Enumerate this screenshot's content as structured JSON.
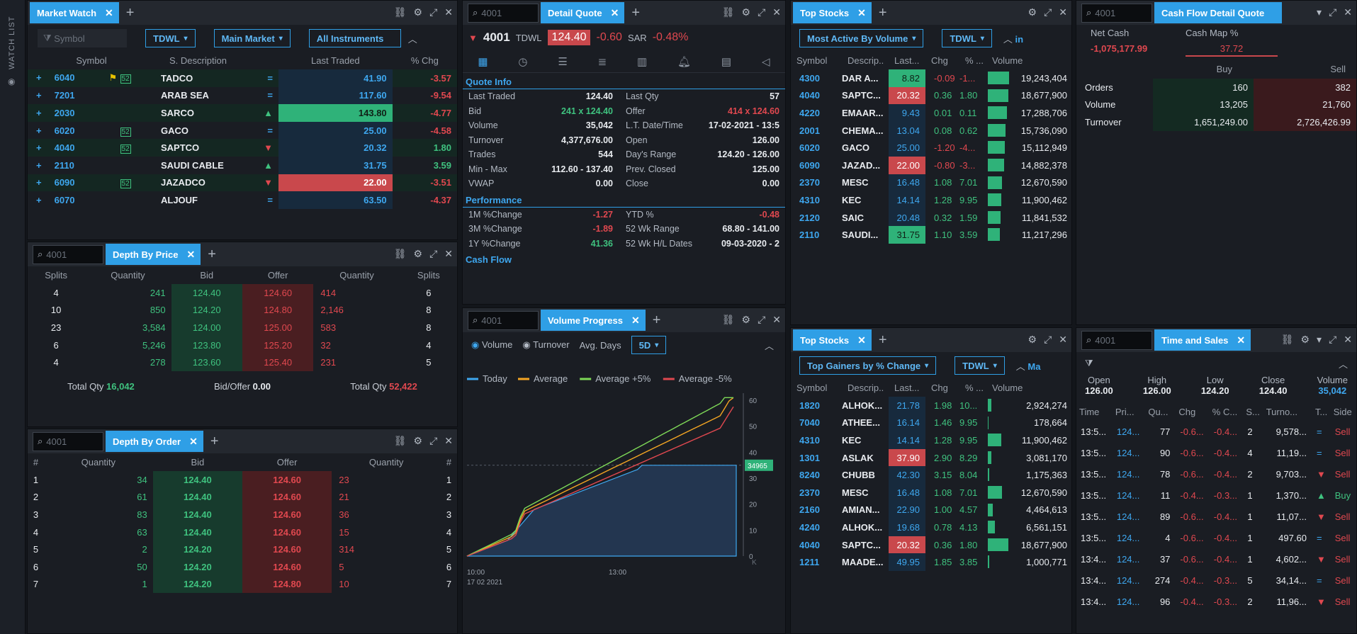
{
  "sidebar": {
    "label": "WATCH LIST",
    "eye": "◉"
  },
  "common": {
    "plus": "+",
    "close": "✕",
    "search_icon": "⌕",
    "chev": "⌄",
    "up": "︿"
  },
  "mw": {
    "tab": "Market Watch",
    "filter_placeholder": "Symbol",
    "dd1": "TDWL",
    "dd2": "Main Market",
    "dd3": "All Instruments",
    "headers": [
      "Symbol",
      "S. Description",
      "Last Traded",
      "% Chg"
    ],
    "rows": [
      {
        "sym": "6040",
        "desc": "TADCO",
        "last": "41.90",
        "chg": "-3.57",
        "flag": "⚑",
        "badge": "52",
        "tr": "=",
        "dir": "dn",
        "hl": ""
      },
      {
        "sym": "7201",
        "desc": "ARAB SEA",
        "last": "117.60",
        "chg": "-9.54",
        "flag": "",
        "badge": "",
        "tr": "=",
        "dir": "dn",
        "hl": ""
      },
      {
        "sym": "2030",
        "desc": "SARCO",
        "last": "143.80",
        "chg": "-4.77",
        "flag": "",
        "badge": "",
        "tr": "▲",
        "dir": "dn",
        "hl": "g"
      },
      {
        "sym": "6020",
        "desc": "GACO",
        "last": "25.00",
        "chg": "-4.58",
        "flag": "",
        "badge": "52",
        "tr": "=",
        "dir": "dn",
        "hl": ""
      },
      {
        "sym": "4040",
        "desc": "SAPTCO",
        "last": "20.32",
        "chg": "1.80",
        "flag": "",
        "badge": "52",
        "tr": "▼",
        "dir": "up",
        "hl": ""
      },
      {
        "sym": "2110",
        "desc": "SAUDI CABLE",
        "last": "31.75",
        "chg": "3.59",
        "flag": "",
        "badge": "",
        "tr": "▲",
        "dir": "up",
        "hl": ""
      },
      {
        "sym": "6090",
        "desc": "JAZADCO",
        "last": "22.00",
        "chg": "-3.51",
        "flag": "",
        "badge": "52",
        "tr": "▼",
        "dir": "dn",
        "hl": "r"
      },
      {
        "sym": "6070",
        "desc": "ALJOUF",
        "last": "63.50",
        "chg": "-4.37",
        "flag": "",
        "badge": "",
        "tr": "=",
        "dir": "dn",
        "hl": ""
      }
    ]
  },
  "dbp": {
    "search": "4001",
    "tab": "Depth By Price",
    "headers": [
      "Splits",
      "Quantity",
      "Bid",
      "Offer",
      "Quantity",
      "Splits"
    ],
    "rows": [
      [
        "4",
        "241",
        "124.40",
        "124.60",
        "414",
        "6"
      ],
      [
        "10",
        "850",
        "124.20",
        "124.80",
        "2,146",
        "8"
      ],
      [
        "23",
        "3,584",
        "124.00",
        "125.00",
        "583",
        "8"
      ],
      [
        "6",
        "5,246",
        "123.80",
        "125.20",
        "32",
        "4"
      ],
      [
        "4",
        "278",
        "123.60",
        "125.40",
        "231",
        "5"
      ]
    ],
    "footer": {
      "tq_label": "Total Qty",
      "tq_bid": "16,042",
      "bo_label": "Bid/Offer",
      "bo": "0.00",
      "tq_label2": "Total Qty",
      "tq_ask": "52,422"
    }
  },
  "dbo": {
    "search": "4001",
    "tab": "Depth By Order",
    "headers": [
      "#",
      "Quantity",
      "Bid",
      "Offer",
      "Quantity",
      "#"
    ],
    "rows": [
      [
        "1",
        "34",
        "124.40",
        "124.60",
        "23",
        "1"
      ],
      [
        "2",
        "61",
        "124.40",
        "124.60",
        "21",
        "2"
      ],
      [
        "3",
        "83",
        "124.40",
        "124.60",
        "36",
        "3"
      ],
      [
        "4",
        "63",
        "124.40",
        "124.60",
        "15",
        "4"
      ],
      [
        "5",
        "2",
        "124.20",
        "124.60",
        "314",
        "5"
      ],
      [
        "6",
        "50",
        "124.20",
        "124.60",
        "5",
        "6"
      ],
      [
        "7",
        "1",
        "124.20",
        "124.80",
        "10",
        "7"
      ]
    ]
  },
  "dq": {
    "search": "4001",
    "tab": "Detail Quote",
    "sym": "4001",
    "exch": "TDWL",
    "price": "124.40",
    "chg": "-0.60",
    "cur": "SAR",
    "pct": "-0.48%",
    "sec_quote": "Quote Info",
    "sec_perf": "Performance",
    "sec_cash": "Cash Flow",
    "qi": [
      [
        "Last Traded",
        "124.40",
        "Last Qty",
        "57"
      ],
      [
        "Bid",
        "241 x 124.40",
        "Offer",
        "414 x 124.60"
      ],
      [
        "Volume",
        "35,042",
        "L.T. Date/Time",
        "17-02-2021 - 13:5"
      ],
      [
        "Turnover",
        "4,377,676.00",
        "Open",
        "126.00"
      ],
      [
        "Trades",
        "544",
        "Day's Range",
        "124.20 - 126.00"
      ],
      [
        "Min - Max",
        "112.60 - 137.40",
        "Prev. Closed",
        "125.00"
      ],
      [
        "VWAP",
        "0.00",
        "Close",
        "0.00"
      ]
    ],
    "perf": [
      [
        "1M %Change",
        "-1.27",
        "YTD %",
        "-0.48"
      ],
      [
        "3M %Change",
        "-1.89",
        "52 Wk Range",
        "68.80 - 141.00"
      ],
      [
        "1Y %Change",
        "41.36",
        "52 Wk H/L Dates",
        "09-03-2020 - 2"
      ]
    ]
  },
  "vp": {
    "search": "4001",
    "tab": "Volume Progress",
    "opt1": "Volume",
    "opt2": "Turnover",
    "avg_label": "Avg. Days",
    "avg_dd": "5D",
    "legend": [
      "Today",
      "Average",
      "Average +5%",
      "Average -5%"
    ],
    "xt": [
      "10:00",
      "13:00"
    ],
    "date": "17 02 2021",
    "yt": [
      "60",
      "50",
      "40",
      "30",
      "20",
      "10",
      "0"
    ],
    "marker": "34965",
    "corner": "K"
  },
  "ts1": {
    "tab": "Top Stocks",
    "dd1": "Most Active By Volume",
    "dd2": "TDWL",
    "more": "in",
    "headers": [
      "Symbol",
      "Descrip..",
      "Last...",
      "Chg",
      "% ...",
      "Volume"
    ],
    "rows": [
      {
        "sym": "4300",
        "d": "DAR A...",
        "l": "8.82",
        "c": "-0.09",
        "p": "-1...",
        "v": "19,243,404",
        "bw": 1.0,
        "hl": "g",
        "dir": "dn"
      },
      {
        "sym": "4040",
        "d": "SAPTC...",
        "l": "20.32",
        "c": "0.36",
        "p": "1.80",
        "v": "18,677,900",
        "bw": 0.97,
        "hl": "r",
        "dir": "up"
      },
      {
        "sym": "4220",
        "d": "EMAAR...",
        "l": "9.43",
        "c": "0.01",
        "p": "0.11",
        "v": "17,288,706",
        "bw": 0.9,
        "hl": "",
        "dir": "up"
      },
      {
        "sym": "2001",
        "d": "CHEMA...",
        "l": "13.04",
        "c": "0.08",
        "p": "0.62",
        "v": "15,736,090",
        "bw": 0.82,
        "hl": "",
        "dir": "up"
      },
      {
        "sym": "6020",
        "d": "GACO",
        "l": "25.00",
        "c": "-1.20",
        "p": "-4...",
        "v": "15,112,949",
        "bw": 0.79,
        "hl": "",
        "dir": "dn"
      },
      {
        "sym": "6090",
        "d": "JAZAD...",
        "l": "22.00",
        "c": "-0.80",
        "p": "-3...",
        "v": "14,882,378",
        "bw": 0.77,
        "hl": "r",
        "dir": "dn"
      },
      {
        "sym": "2370",
        "d": "MESC",
        "l": "16.48",
        "c": "1.08",
        "p": "7.01",
        "v": "12,670,590",
        "bw": 0.66,
        "hl": "",
        "dir": "up"
      },
      {
        "sym": "4310",
        "d": "KEC",
        "l": "14.14",
        "c": "1.28",
        "p": "9.95",
        "v": "11,900,462",
        "bw": 0.62,
        "hl": "",
        "dir": "up"
      },
      {
        "sym": "2120",
        "d": "SAIC",
        "l": "20.48",
        "c": "0.32",
        "p": "1.59",
        "v": "11,841,532",
        "bw": 0.61,
        "hl": "",
        "dir": "up"
      },
      {
        "sym": "2110",
        "d": "SAUDI...",
        "l": "31.75",
        "c": "1.10",
        "p": "3.59",
        "v": "11,217,296",
        "bw": 0.58,
        "hl": "g",
        "dir": "up"
      }
    ]
  },
  "ts2": {
    "tab": "Top Stocks",
    "dd1": "Top Gainers by % Change",
    "dd2": "TDWL",
    "more": "Ma",
    "headers": [
      "Symbol",
      "Descrip..",
      "Last...",
      "Chg",
      "% ...",
      "Volume"
    ],
    "rows": [
      {
        "sym": "1820",
        "d": "ALHOK...",
        "l": "21.78",
        "c": "1.98",
        "p": "10...",
        "v": "2,924,274",
        "bw": 0.15,
        "hl": "",
        "dir": "up"
      },
      {
        "sym": "7040",
        "d": "ATHEE...",
        "l": "16.14",
        "c": "1.46",
        "p": "9.95",
        "v": "178,664",
        "bw": 0.02,
        "hl": "",
        "dir": "up"
      },
      {
        "sym": "4310",
        "d": "KEC",
        "l": "14.14",
        "c": "1.28",
        "p": "9.95",
        "v": "11,900,462",
        "bw": 0.62,
        "hl": "",
        "dir": "up"
      },
      {
        "sym": "1301",
        "d": "ASLAK",
        "l": "37.90",
        "c": "2.90",
        "p": "8.29",
        "v": "3,081,170",
        "bw": 0.16,
        "hl": "r",
        "dir": "up"
      },
      {
        "sym": "8240",
        "d": "CHUBB",
        "l": "42.30",
        "c": "3.15",
        "p": "8.04",
        "v": "1,175,363",
        "bw": 0.06,
        "hl": "",
        "dir": "up"
      },
      {
        "sym": "2370",
        "d": "MESC",
        "l": "16.48",
        "c": "1.08",
        "p": "7.01",
        "v": "12,670,590",
        "bw": 0.66,
        "hl": "",
        "dir": "up"
      },
      {
        "sym": "2160",
        "d": "AMIAN...",
        "l": "22.90",
        "c": "1.00",
        "p": "4.57",
        "v": "4,464,613",
        "bw": 0.23,
        "hl": "",
        "dir": "up"
      },
      {
        "sym": "4240",
        "d": "ALHOK...",
        "l": "19.68",
        "c": "0.78",
        "p": "4.13",
        "v": "6,561,151",
        "bw": 0.34,
        "hl": "",
        "dir": "up"
      },
      {
        "sym": "4040",
        "d": "SAPTC...",
        "l": "20.32",
        "c": "0.36",
        "p": "1.80",
        "v": "18,677,900",
        "bw": 0.97,
        "hl": "r",
        "dir": "up"
      },
      {
        "sym": "1211",
        "d": "MAADE...",
        "l": "49.95",
        "c": "1.85",
        "p": "3.85",
        "v": "1,000,771",
        "bw": 0.05,
        "hl": "",
        "dir": "up"
      }
    ]
  },
  "cf": {
    "search": "4001",
    "tab": "Cash Flow Detail Quote",
    "net_label": "Net Cash",
    "net": "-1,075,177.99",
    "map_label": "Cash Map %",
    "map": "37.72",
    "buy": "Buy",
    "sell": "Sell",
    "rows": [
      [
        "Orders",
        "160",
        "382"
      ],
      [
        "Volume",
        "13,205",
        "21,760"
      ],
      [
        "Turnover",
        "1,651,249.00",
        "2,726,426.99"
      ]
    ]
  },
  "tns": {
    "search": "4001",
    "tab": "Time and Sales",
    "sum_labels": [
      "Open",
      "High",
      "Low",
      "Close",
      "Volume"
    ],
    "sum_vals": [
      "126.00",
      "126.00",
      "124.20",
      "124.40",
      "35,042"
    ],
    "headers": [
      "Time",
      "Pri...",
      "Qu...",
      "Chg",
      "% C...",
      "S...",
      "Turno...",
      "T...",
      "Side"
    ],
    "rows": [
      [
        "13:5...",
        "124...",
        "77",
        "-0.6...",
        "-0.4...",
        "2",
        "9,578...",
        "=",
        "Sell"
      ],
      [
        "13:5...",
        "124...",
        "90",
        "-0.6...",
        "-0.4...",
        "4",
        "11,19...",
        "=",
        "Sell"
      ],
      [
        "13:5...",
        "124...",
        "78",
        "-0.6...",
        "-0.4...",
        "2",
        "9,703...",
        "▼",
        "Sell"
      ],
      [
        "13:5...",
        "124...",
        "11",
        "-0.4...",
        "-0.3...",
        "1",
        "1,370...",
        "▲",
        "Buy"
      ],
      [
        "13:5...",
        "124...",
        "89",
        "-0.6...",
        "-0.4...",
        "1",
        "11,07...",
        "▼",
        "Sell"
      ],
      [
        "13:5...",
        "124...",
        "4",
        "-0.6...",
        "-0.4...",
        "1",
        "497.60",
        "=",
        "Sell"
      ],
      [
        "13:4...",
        "124...",
        "37",
        "-0.6...",
        "-0.4...",
        "1",
        "4,602...",
        "▼",
        "Sell"
      ],
      [
        "13:4...",
        "124...",
        "274",
        "-0.4...",
        "-0.3...",
        "5",
        "34,14...",
        "=",
        "Sell"
      ],
      [
        "13:4...",
        "124...",
        "96",
        "-0.4...",
        "-0.3...",
        "2",
        "11,96...",
        "▼",
        "Sell"
      ]
    ]
  }
}
